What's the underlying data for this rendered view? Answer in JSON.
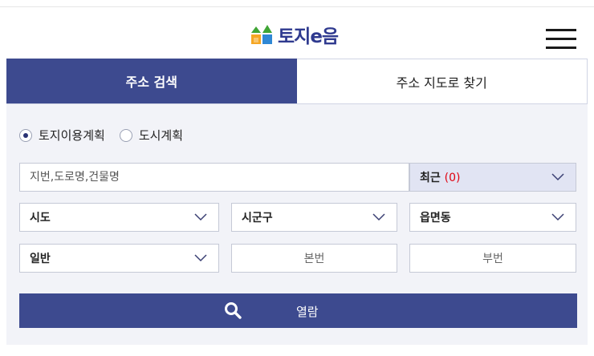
{
  "brand": {
    "logo_text": "토지e음",
    "logo_colors": [
      "#3fa535",
      "#f5a623",
      "#2f88d5",
      "#2f3a8f"
    ]
  },
  "tabs": [
    {
      "label": "주소 검색",
      "active": true
    },
    {
      "label": "주소 지도로 찾기",
      "active": false
    }
  ],
  "plan_type": {
    "options": [
      {
        "label": "토지이용계획",
        "checked": true
      },
      {
        "label": "도시계획",
        "checked": false
      }
    ]
  },
  "search": {
    "placeholder": "지번,도로명,건물명",
    "value": ""
  },
  "recent": {
    "label": "최근",
    "count": "(0)"
  },
  "region": {
    "sido": "시도",
    "sigungu": "시군구",
    "eupmyeondong": "읍면동"
  },
  "lot": {
    "type": "일반",
    "main_placeholder": "본번",
    "sub_placeholder": "부번"
  },
  "submit": {
    "label": "열람",
    "icon": "search-icon"
  },
  "colors": {
    "primary": "#3d4a8f",
    "panel_bg": "#f2f3f8",
    "recent_bg": "#e1e4f3",
    "count_red": "#e0000f"
  }
}
